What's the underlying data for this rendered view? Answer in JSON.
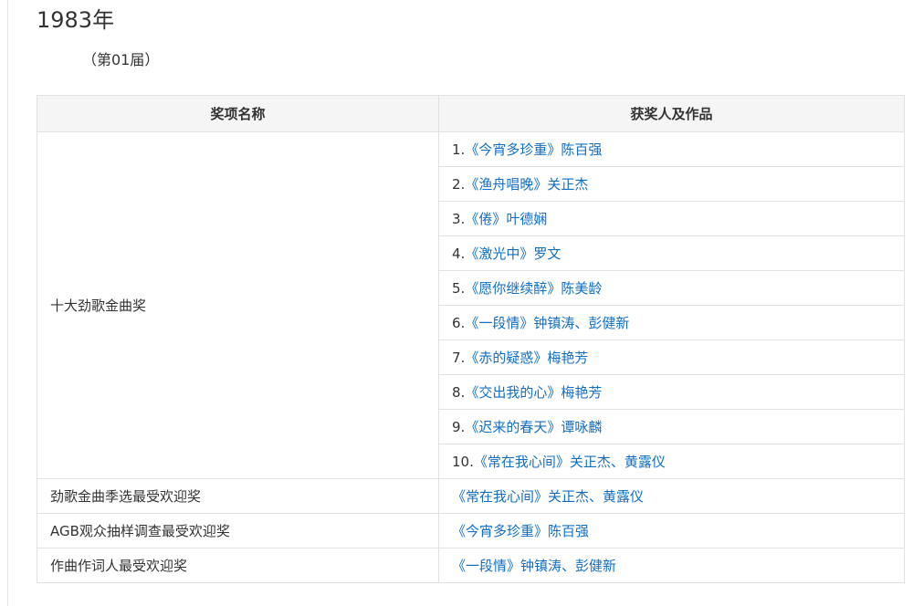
{
  "page": {
    "year": "1983年",
    "edition": "（第01届）"
  },
  "table": {
    "headers": [
      "奖项名称",
      "获奖人及作品"
    ],
    "groups": [
      {
        "award": "十大劲歌金曲奖",
        "winners": [
          {
            "rank": "1.",
            "text": "《今宵多珍重》陈百强"
          },
          {
            "rank": "2.",
            "text": "《渔舟唱晚》关正杰"
          },
          {
            "rank": "3.",
            "text": "《倦》叶德娴"
          },
          {
            "rank": "4.",
            "text": "《激光中》罗文"
          },
          {
            "rank": "5.",
            "text": "《愿你继续醉》陈美龄"
          },
          {
            "rank": "6.",
            "text": "《一段情》钟镇涛、彭健新"
          },
          {
            "rank": "7.",
            "text": "《赤的疑惑》梅艳芳"
          },
          {
            "rank": "8.",
            "text": "《交出我的心》梅艳芳"
          },
          {
            "rank": "9.",
            "text": "《迟来的春天》谭咏麟"
          },
          {
            "rank": "10.",
            "text": "《常在我心间》关正杰、黄露仪"
          }
        ]
      },
      {
        "award": "劲歌金曲季选最受欢迎奖",
        "winners": [
          {
            "rank": "",
            "text": "《常在我心间》关正杰、黄露仪"
          }
        ]
      },
      {
        "award": "AGB观众抽样调查最受欢迎奖",
        "winners": [
          {
            "rank": "",
            "text": "《今宵多珍重》陈百强"
          }
        ]
      },
      {
        "award": "作曲作词人最受欢迎奖",
        "winners": [
          {
            "rank": "",
            "text": "《一段情》钟镇涛、彭健新"
          }
        ]
      }
    ]
  }
}
